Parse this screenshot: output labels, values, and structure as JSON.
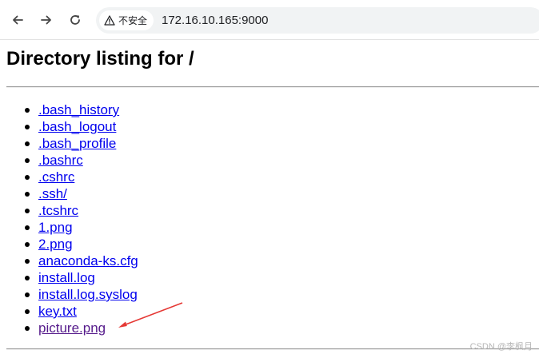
{
  "toolbar": {
    "back_icon": "arrow-left-icon",
    "forward_icon": "arrow-right-icon",
    "reload_icon": "reload-icon",
    "security_icon": "warning-triangle-icon",
    "security_label": "不安全",
    "url": "172.16.10.165:9000"
  },
  "page": {
    "title": "Directory listing for /",
    "files": [
      {
        "name": ".bash_history",
        "visited": false
      },
      {
        "name": ".bash_logout",
        "visited": false
      },
      {
        "name": ".bash_profile",
        "visited": false
      },
      {
        "name": ".bashrc",
        "visited": false
      },
      {
        "name": ".cshrc",
        "visited": false
      },
      {
        "name": ".ssh/",
        "visited": false
      },
      {
        "name": ".tcshrc",
        "visited": false
      },
      {
        "name": "1.png",
        "visited": false
      },
      {
        "name": "2.png",
        "visited": false
      },
      {
        "name": "anaconda-ks.cfg",
        "visited": false
      },
      {
        "name": "install.log",
        "visited": false
      },
      {
        "name": "install.log.syslog",
        "visited": false
      },
      {
        "name": "key.txt",
        "visited": false
      },
      {
        "name": "picture.png",
        "visited": true
      }
    ]
  },
  "annotation": {
    "color": "#e53935",
    "target": "picture.png"
  },
  "watermark": "CSDN @李枫月",
  "colors": {
    "link": "#0000ee",
    "visited_link": "#551a8b"
  }
}
